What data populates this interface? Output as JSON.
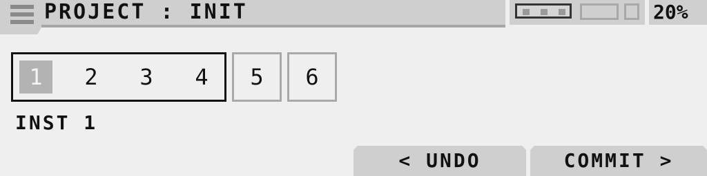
{
  "header": {
    "title": "PROJECT : INIT",
    "zoom": "20%",
    "menu_icon": "hamburger-menu-icon",
    "meter_icon": "level-meter-icon"
  },
  "pattern_slots": {
    "group": [
      {
        "label": "1",
        "selected": true
      },
      {
        "label": "2",
        "selected": false
      },
      {
        "label": "3",
        "selected": false
      },
      {
        "label": "4",
        "selected": false
      }
    ],
    "extra": [
      {
        "label": "5"
      },
      {
        "label": "6"
      }
    ]
  },
  "instrument": {
    "label": "INST 1"
  },
  "buttons": {
    "undo_label": "< UNDO",
    "commit_label": "COMMIT >"
  },
  "colors": {
    "background": "#efefef",
    "panel": "#cfcfcf",
    "selected": "#b3b3b3",
    "text": "#111111",
    "border_muted": "#a8a8a8"
  }
}
